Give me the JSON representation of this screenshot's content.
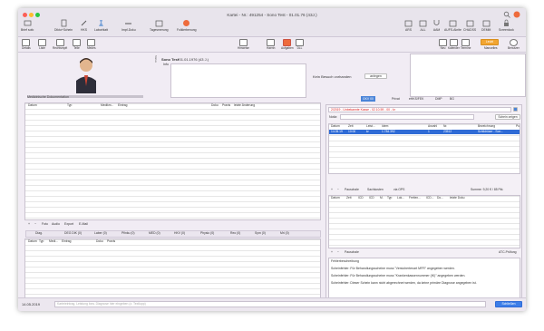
{
  "window": {
    "title": "Kartei - Nr.: 491254 - Sono Test - 01.01.76 (43J.)"
  },
  "toolbar": {
    "items": [
      "Brief sofo",
      "Diktu+Schein",
      "HKS",
      "Laborblatt",
      "Impf-Doku",
      "Tagesmerung",
      "Folklerbenung"
    ],
    "right_items": [
      "ARS",
      "ALL",
      "AAM",
      "AUFS-Akrite",
      "CHADSS",
      "DEMM",
      "Screenlock"
    ]
  },
  "toolbar2": {
    "items": [
      "Details",
      "Liste",
      "Rechtsmpft",
      "Telle",
      "Medes"
    ],
    "mid_items": [
      "Hinweise",
      "Haerin",
      "Aufgaben",
      "DLL"
    ],
    "right_items": [
      "Neu",
      "Kalender",
      "Termine",
      "Manuelles",
      "Benutzer"
    ],
    "orange_btn": "Leubl"
  },
  "patient": {
    "name": "Sono Test",
    "dob": "*01.01.1976 (43 J.)",
    "info_label": "Info",
    "side_label": "Status",
    "no_visit": "Kein Besuch vorhanden",
    "create_btn": "anlegen"
  },
  "docs": {
    "title": "Medizinische Dokumentation",
    "columns": [
      "Datum",
      "Typ",
      "Medikm...",
      "Eintrag",
      "Doku",
      "Praxis",
      "letzte Änderung"
    ],
    "bottom_btns": [
      "+",
      "−",
      "Foto",
      "Audio",
      "Export",
      "E-Mail"
    ]
  },
  "bottom_tabs": [
    "Diag.",
    "DEG DIK (0)",
    "Laber (0)",
    "Pfinku (0)",
    "MED (0)",
    "HKV (0)",
    "Physio (0)",
    "Reo (0)",
    "Sym (0)",
    "Mri (0)"
  ],
  "bottom_cols": [
    "Datum",
    "Typ",
    "Medi...",
    "Eintrag",
    "Doku",
    "Praxis"
  ],
  "right": {
    "tabs": [
      "GKV 00",
      "Privat",
      "eHKS/FEK",
      "DMP",
      "BG"
    ],
    "case": "2/2019 - Unbekannte Kasse - 02.10.59 - 00 - kr",
    "notiz_label": "Notiz:",
    "schein_btn": "Schein zeigen",
    "columns": [
      "Datum",
      "Zeit",
      "Leist...",
      "Idem",
      "Anzahl",
      "Nr.",
      "Bezeichnung",
      "Pu"
    ],
    "row": [
      "14.05.19",
      "10:00",
      "kr",
      "1.784.392",
      "1",
      "23512",
      "Schildrüser - Son..."
    ],
    "pauschalen_btns": [
      "+",
      "−",
      "Pauschale",
      "Sachkosten",
      "via OPS"
    ],
    "summe": "Summe: 9,20 € / 85 Pkt.",
    "diag_cols": [
      "Datum",
      "Zeit",
      "ICD",
      "ICD",
      "M.",
      "Typ",
      "Lok...",
      "Freitex...",
      "ICD...",
      "Do...",
      "letzte Doku"
    ],
    "diag_btns": [
      "+",
      "−",
      "Pauschale"
    ],
    "atc": "ATC-Prüfung",
    "err_title": "Fehlerbeschreibung",
    "errors": [
      "Scheinfehler: Für Behandlungsscheine muss \"Versichertenart MFR\" angegeben werden.",
      "Scheinfehler: Für Behandlungsscheine muss \"Krankenkassennummer (IK)\" angegeben werden.",
      "Scheinfehler: Dieser Schein kann nicht abgerechnet werden, da keine primäre Diagnose angegeben ist."
    ]
  },
  "footer": {
    "date": "14.05.2019",
    "placeholder": "Karteieintrag, Leistung bzw. Diagnose hier eingeben (z. Textlupp)",
    "save_btn": "Schließen"
  }
}
